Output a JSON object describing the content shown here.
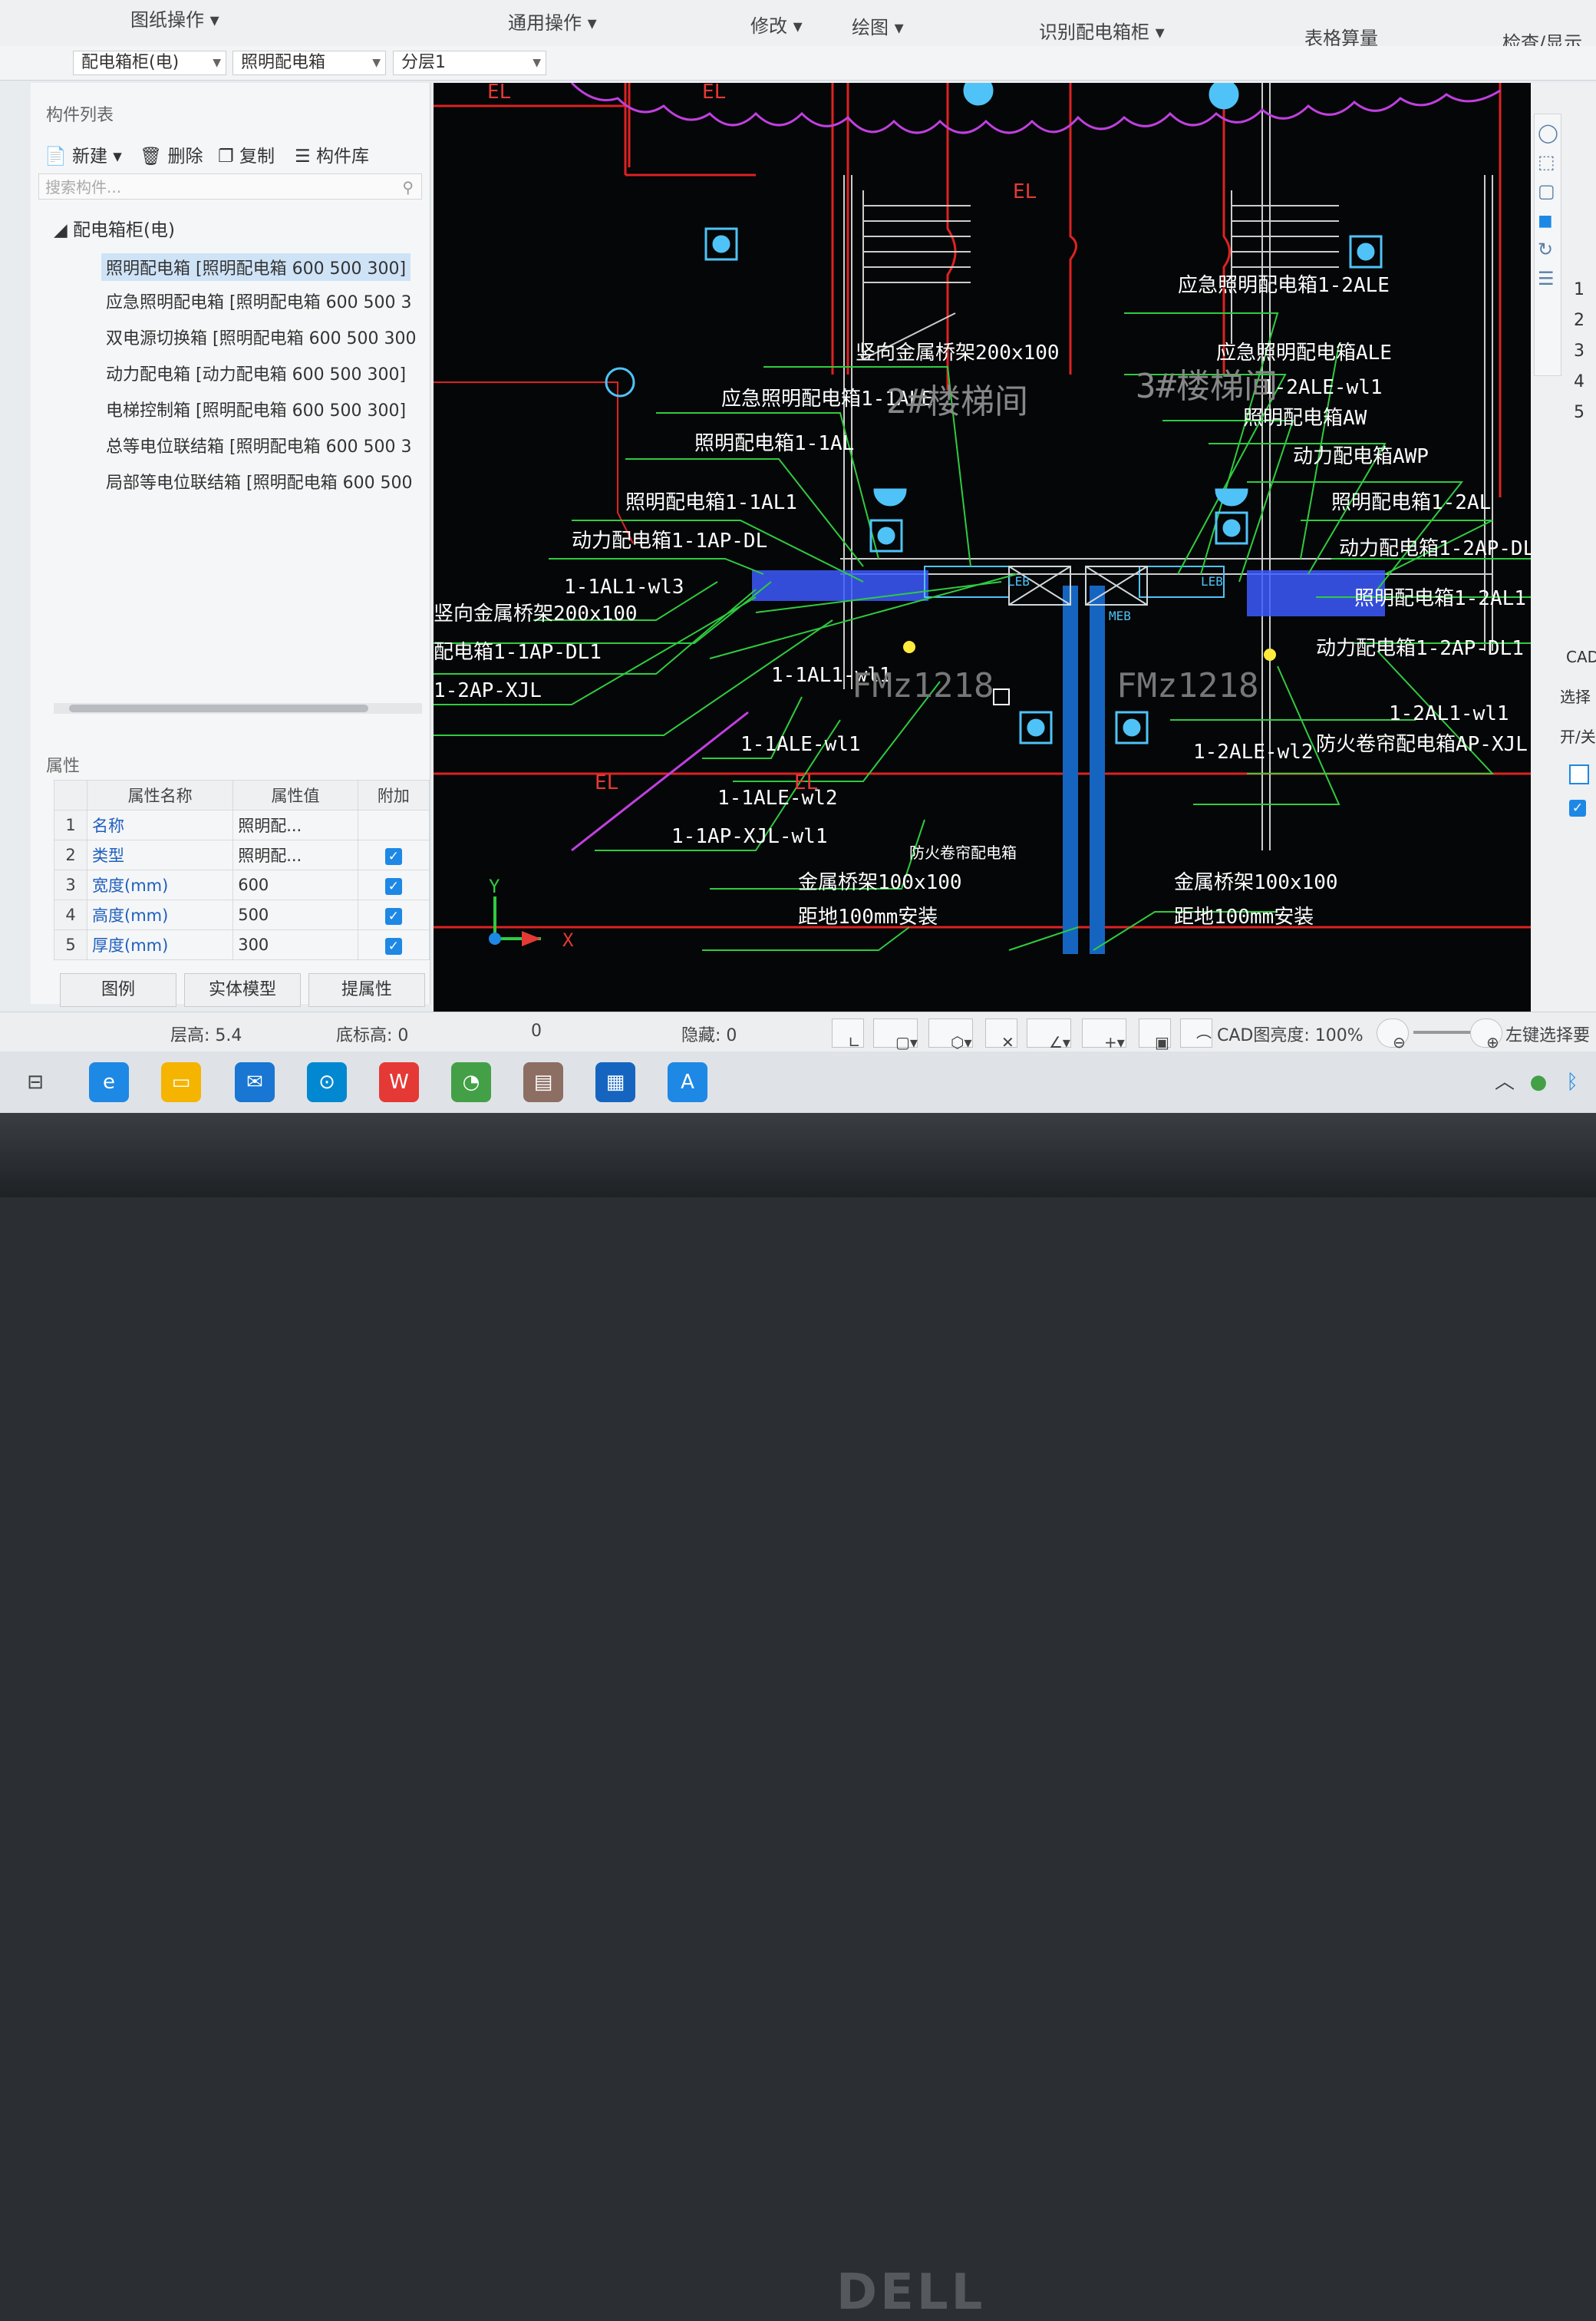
{
  "ribbon": {
    "groups": [
      "图纸操作",
      "通用操作",
      "修改",
      "绘图",
      "识别配电箱柜",
      "表格算量",
      "检查/显示"
    ]
  },
  "toolbar": {
    "combo1": "配电箱柜(电)",
    "combo2": "照明配电箱",
    "combo3": "分层1"
  },
  "component_list": {
    "title": "构件列表",
    "buttons": {
      "new": "新建",
      "delete": "删除",
      "copy": "复制",
      "library": "构件库"
    },
    "search_placeholder": "搜索构件...",
    "category": "配电箱柜(电)",
    "items": [
      "照明配电箱 [照明配电箱 600 500 300]",
      "应急照明配电箱 [照明配电箱 600 500 3",
      "双电源切换箱 [照明配电箱 600 500 300",
      "动力配电箱 [动力配电箱 600 500 300]",
      "电梯控制箱 [照明配电箱 600 500 300]",
      "总等电位联结箱 [照明配电箱 600 500 3",
      "局部等电位联结箱 [照明配电箱 600 500"
    ]
  },
  "properties": {
    "title": "属性",
    "headers": [
      "属性名称",
      "属性值",
      "附加"
    ],
    "rows": [
      {
        "idx": "1",
        "name": "名称",
        "value": "照明配..."
      },
      {
        "idx": "2",
        "name": "类型",
        "value": "照明配..."
      },
      {
        "idx": "3",
        "name": "宽度(mm)",
        "value": "600"
      },
      {
        "idx": "4",
        "name": "高度(mm)",
        "value": "500"
      },
      {
        "idx": "5",
        "name": "厚度(mm)",
        "value": "300"
      }
    ],
    "tabs": [
      "图例",
      "实体模型",
      "提属性"
    ]
  },
  "cad": {
    "labels": [
      "EL",
      "EL",
      "EL",
      "EL",
      "EL",
      "竖向金属桥架200x100",
      "应急照明配电箱1-1ALE",
      "照明配电箱1-1AL",
      "照明配电箱1-1AL1",
      "动力配电箱1-1AP-DL",
      "1-1AL1-wl3",
      "竖向金属桥架200x100",
      "配电箱1-1AP-DL1",
      "1-2AP-XJL",
      "1-1AL1-wl1",
      "1-1ALE-wl1",
      "1-1ALE-wl2",
      "1-1AP-XJL-wl1",
      "防火卷帘配电箱",
      "金属桥架100x100",
      "距地100mm安装",
      "金属桥架100x100",
      "距地100mm安装",
      "应急照明配电箱1-2ALE",
      "应急照明配电箱ALE",
      "1-2ALE-wl1",
      "照明配电箱AW",
      "动力配电箱AWP",
      "照明配电箱1-2AL",
      "动力配电箱1-2AP-DL",
      "照明配电箱1-2AL1",
      "动力配电箱1-2AP-DL1",
      "1-2AL1-wl1",
      "1-2ALE-wl2",
      "防火卷帘配电箱AP-XJL",
      "2#楼梯间",
      "3#楼梯间",
      "FMz1218",
      "FMz1218",
      "LEB",
      "LEB",
      "MEB",
      "Y",
      "X"
    ]
  },
  "statusbar": {
    "floor_height": "层高: 5.4",
    "bottom_elev": "底标高: 0",
    "zero": "0",
    "hidden": "隐藏: 0",
    "cad_brightness": "CAD图亮度: 100%",
    "hint": "左键选择要识"
  },
  "rightbar": {
    "numbers": [
      "1",
      "2",
      "3",
      "4",
      "5"
    ],
    "cad_label": "CAD",
    "select_label": "选择",
    "toggle_label": "开/关"
  },
  "brand": "DELL"
}
